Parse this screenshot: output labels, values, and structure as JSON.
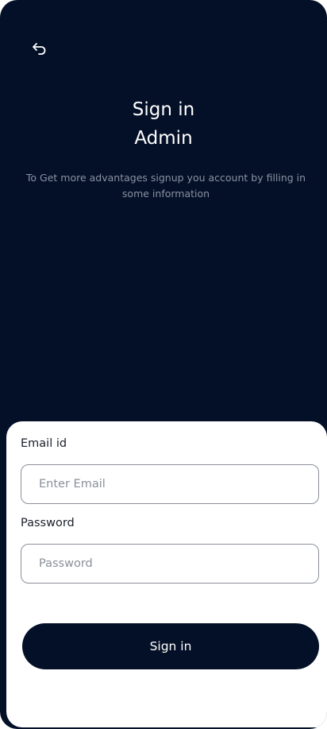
{
  "header": {
    "back_icon": "back-arrow-icon",
    "title_line1": "Sign in",
    "title_line2": "Admin",
    "subtitle": "To Get more advantages signup you account by filling in some information"
  },
  "form": {
    "email_label": "Email id",
    "email_placeholder": "Enter Email",
    "email_value": "",
    "password_label": "Password",
    "password_placeholder": "Password",
    "password_value": "",
    "submit_label": "Sign in"
  },
  "colors": {
    "background": "#041027",
    "sheet": "#ffffff",
    "button": "#041027",
    "subtitle_text": "#8a91a3",
    "field_border": "#8a8f99"
  }
}
